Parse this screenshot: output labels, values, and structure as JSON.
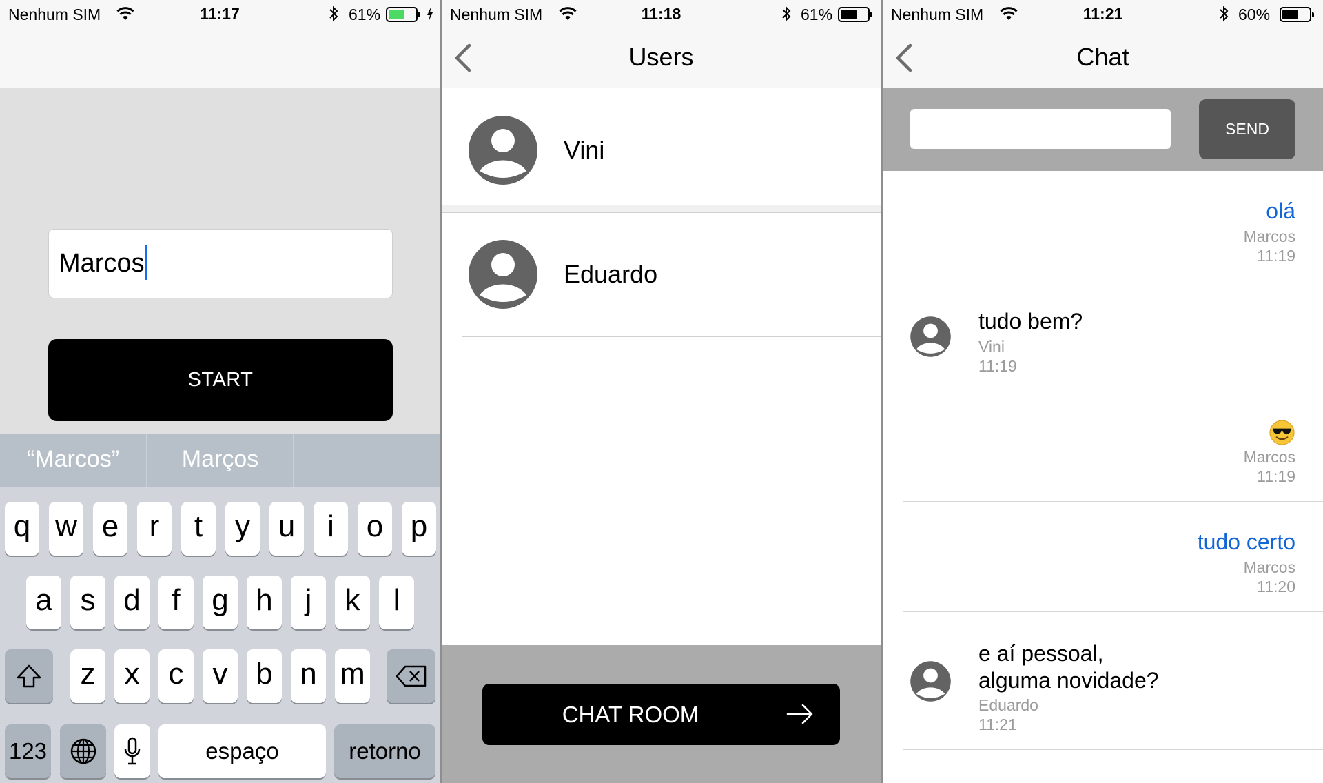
{
  "screens": {
    "login": {
      "status": {
        "carrier": "Nenhum SIM",
        "time": "11:17",
        "battery": "61%",
        "battery_level": 0.61,
        "battery_color": "#4cd964",
        "charging": true
      },
      "name_input": {
        "value": "Marcos"
      },
      "start_button": "START",
      "keyboard": {
        "suggestions": [
          "“Marcos”",
          "Marços",
          ""
        ],
        "row1": [
          "q",
          "w",
          "e",
          "r",
          "t",
          "y",
          "u",
          "i",
          "o",
          "p"
        ],
        "row2": [
          "a",
          "s",
          "d",
          "f",
          "g",
          "h",
          "j",
          "k",
          "l"
        ],
        "row3": [
          "z",
          "x",
          "c",
          "v",
          "b",
          "n",
          "m"
        ],
        "numbers_key": "123",
        "space_key": "espaço",
        "return_key": "retorno",
        "icons": [
          "shift-icon",
          "backspace-icon",
          "globe-icon",
          "microphone-icon"
        ]
      }
    },
    "users": {
      "status": {
        "carrier": "Nenhum SIM",
        "time": "11:18",
        "battery": "61%",
        "battery_level": 0.61,
        "battery_color": "#000000",
        "charging": false
      },
      "title": "Users",
      "users": [
        {
          "name": "Vini"
        },
        {
          "name": "Eduardo"
        }
      ],
      "chat_room_button": "CHAT ROOM"
    },
    "chat": {
      "status": {
        "carrier": "Nenhum SIM",
        "time": "11:21",
        "battery": "60%",
        "battery_level": 0.6,
        "battery_color": "#000000",
        "charging": false
      },
      "title": "Chat",
      "message_input": {
        "value": "",
        "placeholder": ""
      },
      "send_button": "SEND",
      "messages": [
        {
          "side": "right",
          "text": "olá",
          "author": "Marcos",
          "time": "11:19",
          "color": "#1366d6"
        },
        {
          "side": "left",
          "text": "tudo bem?",
          "author": "Vini",
          "time": "11:19"
        },
        {
          "side": "right",
          "emoji": "smiling-face-with-sunglasses",
          "author": "Marcos",
          "time": "11:19"
        },
        {
          "side": "right",
          "text": "tudo certo",
          "author": "Marcos",
          "time": "11:20",
          "color": "#1366d6"
        },
        {
          "side": "left",
          "text_lines": [
            "e aí pessoal,",
            "alguma novidade?"
          ],
          "author": "Eduardo",
          "time": "11:21"
        }
      ]
    }
  }
}
